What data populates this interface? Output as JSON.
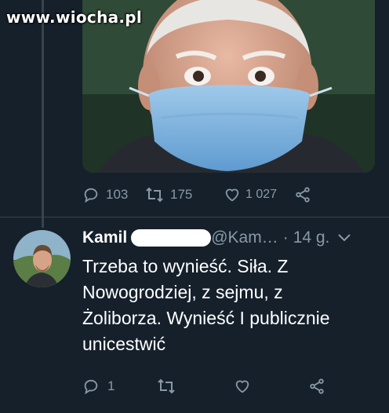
{
  "watermark": {
    "text": "www.wiocha.pl"
  },
  "quoted_tweet": {
    "media_alt_icon": "photo",
    "actions": {
      "reply_count": "103",
      "retweet_count": "175",
      "like_count": "1 027"
    }
  },
  "reply": {
    "author_name": "Kamil",
    "handle": "@Kam…",
    "separator": "·",
    "time": "14 g.",
    "text_lines": [
      "Trzeba to wynieść. Siła. Z",
      "Nowogrodziej, z sejmu, z",
      "Żoliborza. Wynieść I publicznie",
      "unicestwić"
    ],
    "actions": {
      "reply_count": "1",
      "retweet_count": "",
      "like_count": ""
    }
  },
  "colors": {
    "background": "#15202b",
    "secondary_text": "#8899a6",
    "divider": "#38444d"
  }
}
